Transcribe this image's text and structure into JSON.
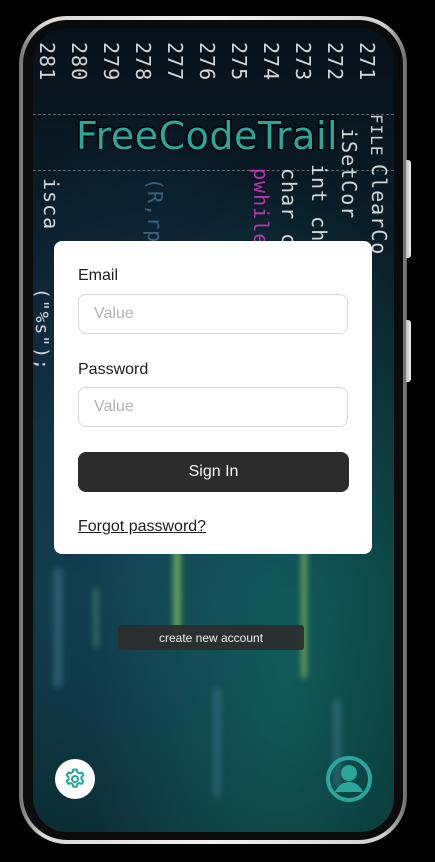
{
  "app": {
    "title": "FreeCodeTrail"
  },
  "background_code": {
    "line_numbers": [
      "281",
      "280",
      "279",
      "278",
      "277",
      "276",
      "275",
      "274",
      "273",
      "272",
      "271"
    ],
    "snippets": [
      "isca",
      "(\"%s\");",
      "(R,rp",
      "pwhile(",
      "char c",
      "int ch",
      "iSetCor",
      "ClearCo",
      "FILE"
    ]
  },
  "login_form": {
    "email_label": "Email",
    "email_placeholder": "Value",
    "password_label": "Password",
    "password_placeholder": "Value",
    "signin_label": "Sign In",
    "forgot_label": "Forgot password?"
  },
  "create_account_label": "create new account",
  "icons": {
    "settings": "gear-icon",
    "profile": "user-circle-icon"
  },
  "colors": {
    "accent": "#2aa69a",
    "button_dark": "#2c2c2c",
    "card_bg": "#ffffff"
  }
}
